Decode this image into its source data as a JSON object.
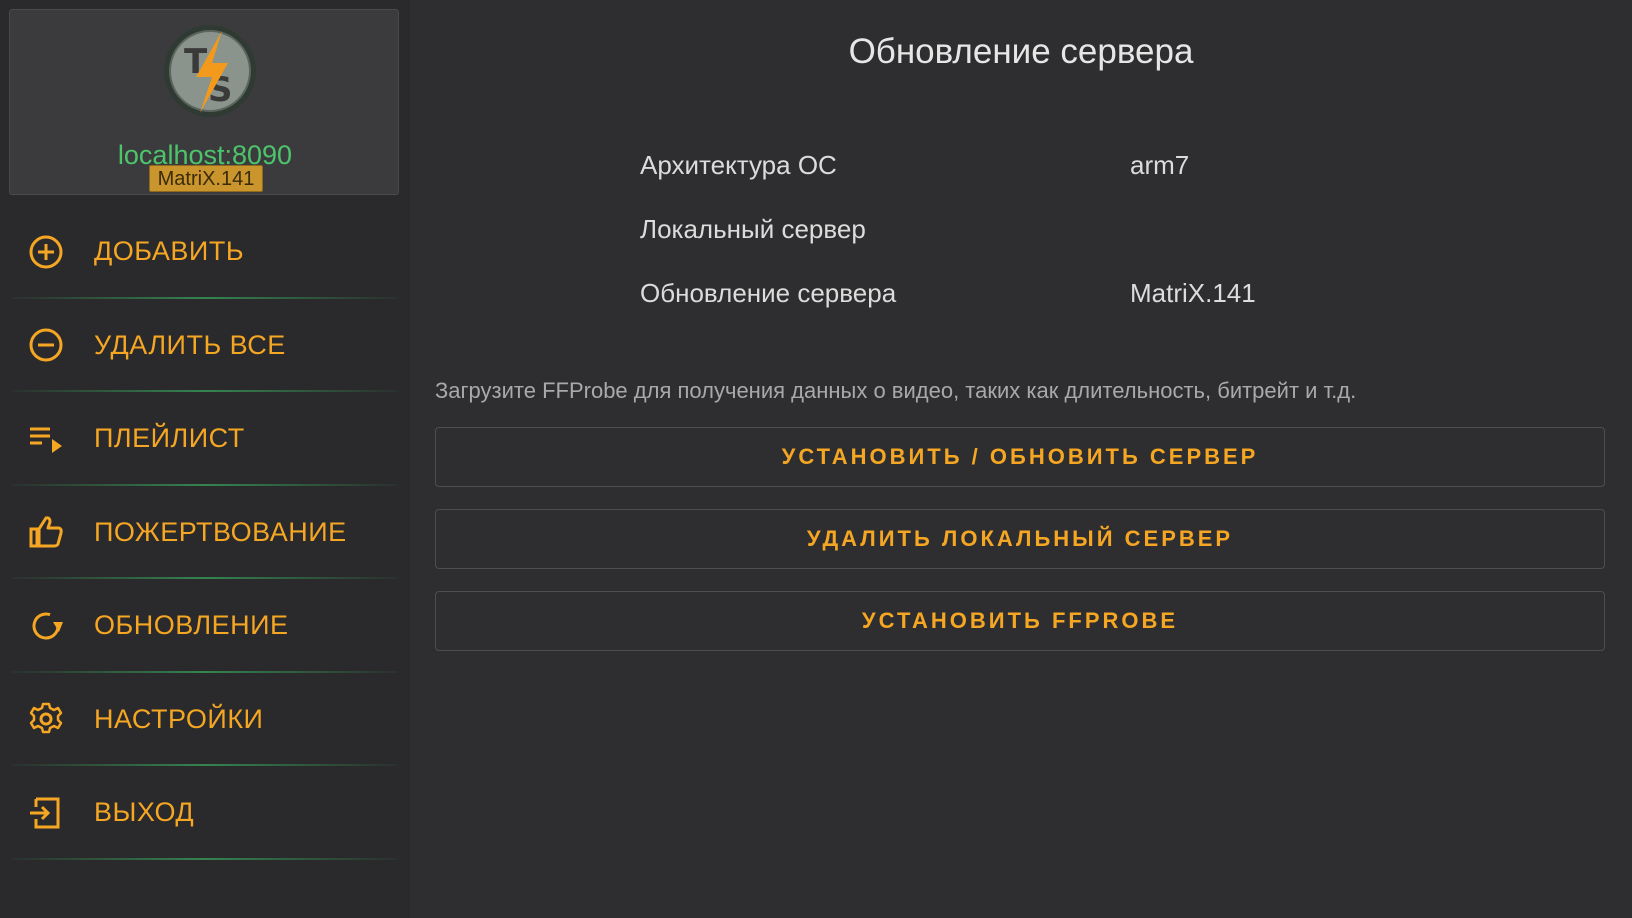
{
  "sidebar": {
    "profile": {
      "logo_icon": "ts-lightning-logo-icon",
      "host": "localhost:8090",
      "version": "MatriX.141"
    },
    "items": [
      {
        "label": "ДОБАВИТЬ",
        "icon": "plus-circle-icon"
      },
      {
        "label": "УДАЛИТЬ ВСЕ",
        "icon": "minus-circle-icon"
      },
      {
        "label": "ПЛЕЙЛИСТ",
        "icon": "playlist-play-icon"
      },
      {
        "label": "ПОЖЕРТВОВАНИЕ",
        "icon": "thumb-up-icon"
      },
      {
        "label": "ОБНОВЛЕНИЕ",
        "icon": "refresh-icon"
      },
      {
        "label": "НАСТРОЙКИ",
        "icon": "gear-icon"
      },
      {
        "label": "ВЫХОД",
        "icon": "exit-icon"
      }
    ]
  },
  "main": {
    "title": "Обновление сервера",
    "info": [
      {
        "label": "Архитектура ОС",
        "value": "arm7"
      },
      {
        "label": "Локальный сервер",
        "value": ""
      },
      {
        "label": "Обновление сервера",
        "value": "MatriX.141"
      }
    ],
    "hint": "Загрузите FFProbe для получения данных о видео, таких как длительность, битрейт и т.д.",
    "buttons": {
      "install_update": "УСТАНОВИТЬ / ОБНОВИТЬ СЕРВЕР",
      "remove_local": "УДАЛИТЬ ЛОКАЛЬНЫЙ СЕРВЕР",
      "install_ffprobe": "УСТАНОВИТЬ FFPROBE"
    }
  },
  "colors": {
    "accent": "#f5a623",
    "host_green": "#4cc56a",
    "background": "#2e2e30"
  }
}
